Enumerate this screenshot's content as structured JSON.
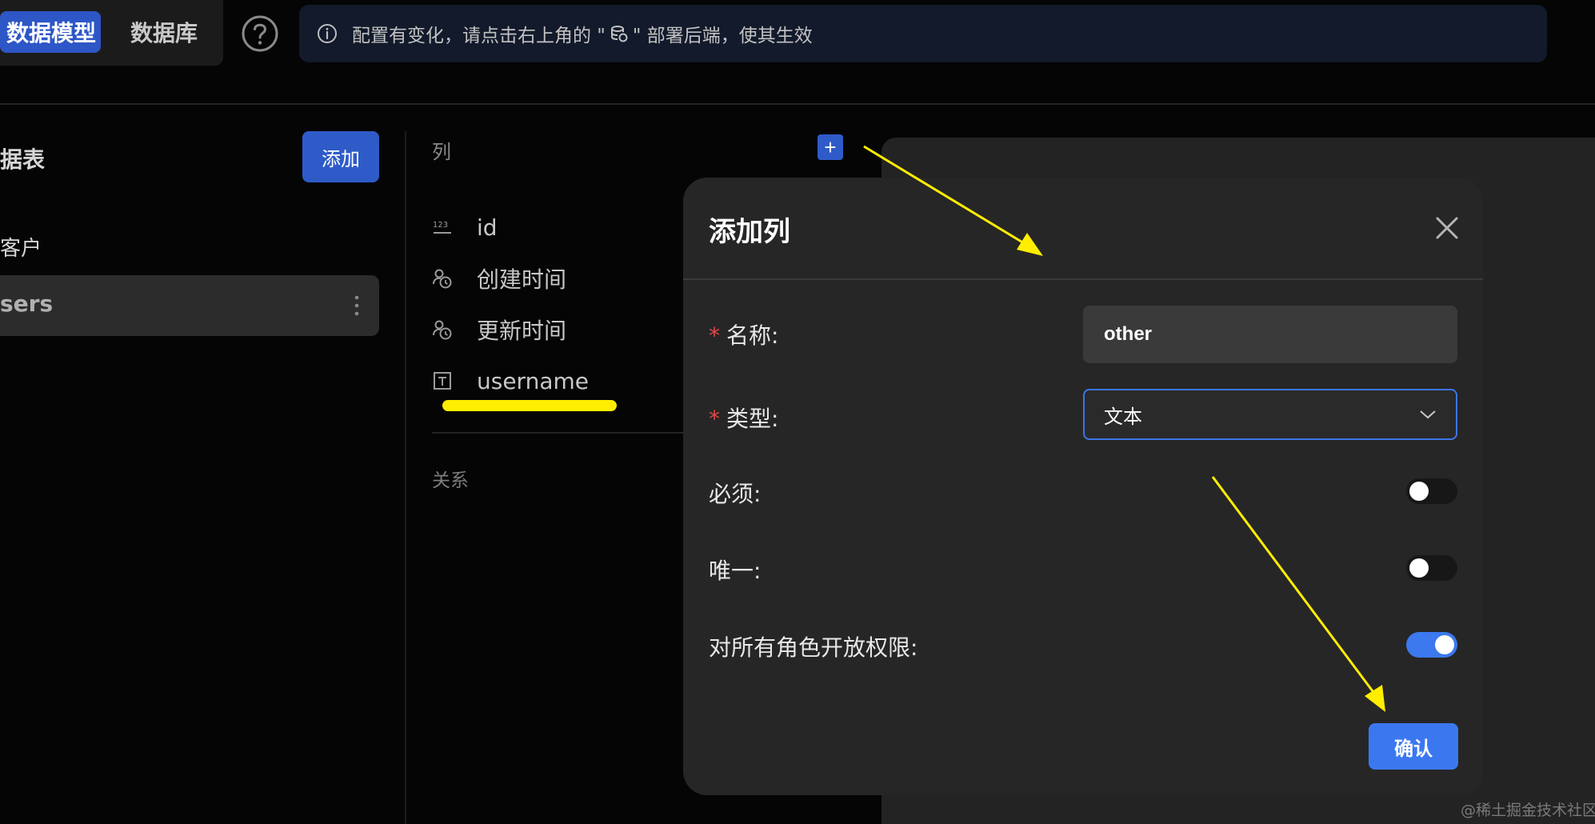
{
  "header": {
    "tabs": [
      {
        "label": "数据模型",
        "active": true
      },
      {
        "label": "数据库",
        "active": false
      }
    ],
    "notice": {
      "text_before": "配置有变化，请点击右上角的 \"",
      "text_after": "\" 部署后端，使其生效"
    }
  },
  "sidebar": {
    "title": "据表",
    "add_label": "添加",
    "group_label": "客户",
    "selected_item": "sers"
  },
  "columns_panel": {
    "heading": "列",
    "add_symbol": "+",
    "fields": [
      {
        "name": "id",
        "icon": "number-type-icon"
      },
      {
        "name": "创建时间",
        "icon": "created-time-icon"
      },
      {
        "name": "更新时间",
        "icon": "updated-time-icon"
      },
      {
        "name": "username",
        "icon": "text-type-icon"
      }
    ],
    "relations_heading": "关系"
  },
  "modal": {
    "title": "添加列",
    "name_label": "名称:",
    "name_value": "other",
    "type_label": "类型:",
    "type_value": "文本",
    "required_label": "必须:",
    "required_on": false,
    "unique_label": "唯一:",
    "unique_on": false,
    "open_permissions_label": "对所有角色开放权限:",
    "open_permissions_on": true,
    "confirm_label": "确认",
    "required_mark": "*"
  },
  "watermark": "@稀土掘金技术社区",
  "colors": {
    "accent": "#3b78f0",
    "highlight": "#ffee00",
    "required": "#e04848",
    "annotation_arrow": "#ffee00"
  }
}
